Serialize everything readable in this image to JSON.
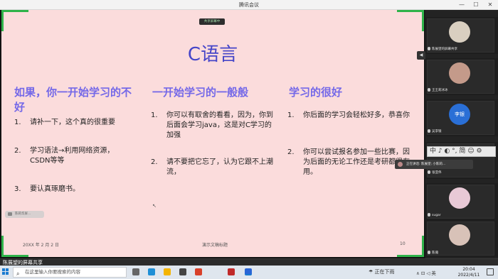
{
  "window": {
    "title": "腾讯会议",
    "minimize": "—",
    "maximize": "☐",
    "close": "✕"
  },
  "share_tag": "共享屏幕中",
  "slide": {
    "title": "C语言",
    "columns": [
      {
        "heading": "如果，你一开始学习的不好",
        "items": [
          {
            "num": "1.",
            "text": "请补一下，这个真的很重要"
          },
          {
            "num": "2.",
            "text": "学习语法→利用网络资源，CSDN等等"
          },
          {
            "num": "3.",
            "text": "要认真琢磨书。"
          }
        ]
      },
      {
        "heading": "一开始学习的一般般",
        "items": [
          {
            "num": "1.",
            "text": "你可以有取舍的看看，因为，你到后面会学习java，这是对C学习的加强"
          },
          {
            "num": "2.",
            "text": "请不要把它忘了，认为它跟不上潮流，"
          }
        ]
      },
      {
        "heading": "学习的很好",
        "items": [
          {
            "num": "1.",
            "text": "你后面的学习会轻松好多，恭喜你"
          },
          {
            "num": "2.",
            "text": "你可以尝试报名参加一些比赛，因为后面的无论工作还是考研都很有用。"
          }
        ]
      }
    ],
    "footer": {
      "date": "20XX 年 2 月 2 日",
      "center": "演示文稿标题",
      "page": "10"
    }
  },
  "pill_text": "陈莉华屏...",
  "participants": [
    {
      "name": "陈展望的屏幕共享",
      "avatar_color": "#d9cfc0"
    },
    {
      "name": "王王莉冰冰",
      "avatar_color": "#c49a8a"
    },
    {
      "name": "吴李银",
      "initials": "李银",
      "avatar_color": "#2a6fd6"
    },
    {
      "name": "张亚伟",
      "avatar_color": "#8a8a8a"
    },
    {
      "name": "sugar",
      "avatar_color": "#e8c9d6"
    },
    {
      "name": "陈瀚",
      "avatar_color": "#d8c2b8"
    }
  ],
  "ime": {
    "text": "中 ♪ ◐ °, 简 ☺ ⚙"
  },
  "speaking": "正在讲话: 陈展望; 小陈莉...",
  "banner": "陈展望的屏幕共享",
  "taskbar": {
    "search_placeholder": "在这里输入你要搜索的内容",
    "search_icon": "⌕",
    "weather": "☂ 正在下雨",
    "tray": "∧ ⊡ ◁ 英",
    "time": "20:04",
    "date": "2022/4/11",
    "app_colors": [
      "#666666",
      "#1f8fd6",
      "#f4b400",
      "#444444",
      "#d8402a",
      "#c02a2a",
      "#2a66d6"
    ]
  }
}
